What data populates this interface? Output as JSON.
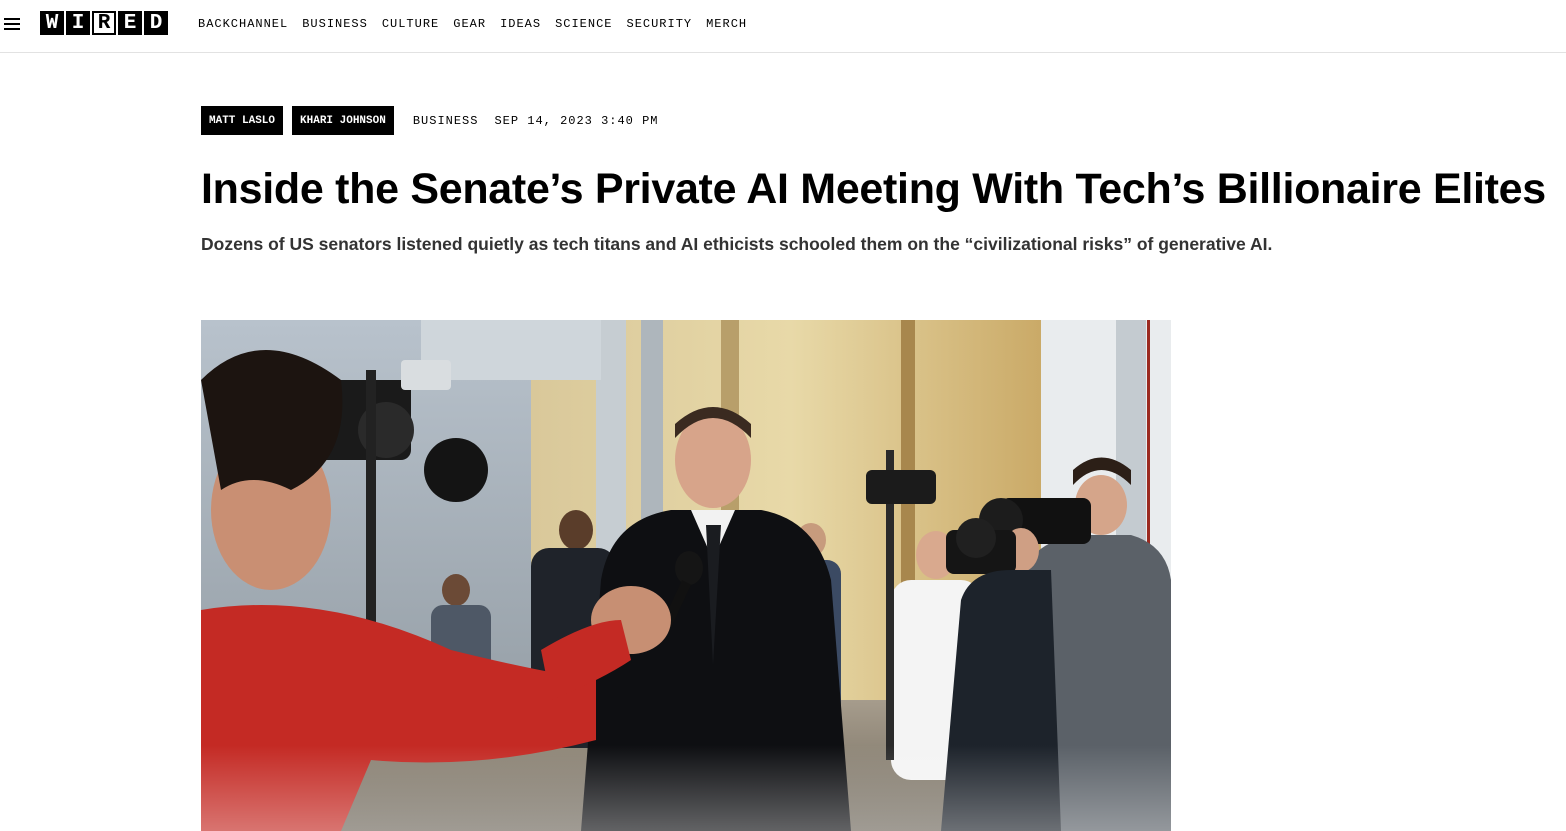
{
  "header": {
    "logo_letters": [
      "W",
      "I",
      "R",
      "E",
      "D"
    ],
    "nav": [
      {
        "label": "BACKCHANNEL"
      },
      {
        "label": "BUSINESS"
      },
      {
        "label": "CULTURE"
      },
      {
        "label": "GEAR"
      },
      {
        "label": "IDEAS"
      },
      {
        "label": "SCIENCE"
      },
      {
        "label": "SECURITY"
      },
      {
        "label": "MERCH"
      }
    ],
    "menu_icon": "hamburger-icon"
  },
  "article": {
    "authors": [
      "MATT LASLO",
      "KHARI JOHNSON"
    ],
    "rubric": "BUSINESS",
    "date": "SEP 14, 2023 3:40 PM",
    "headline": "Inside the Senate’s Private AI Meeting With Tech’s Billionaire Elites",
    "dek": "Dozens of US senators listened quietly as tech titans and AI ethicists schooled them on the “civilizational risks” of generative AI."
  },
  "colors": {
    "text": "#000000",
    "dek": "#333333",
    "byline_bg": "#000000",
    "byline_text": "#ffffff",
    "header_border": "#e2e2e2"
  }
}
